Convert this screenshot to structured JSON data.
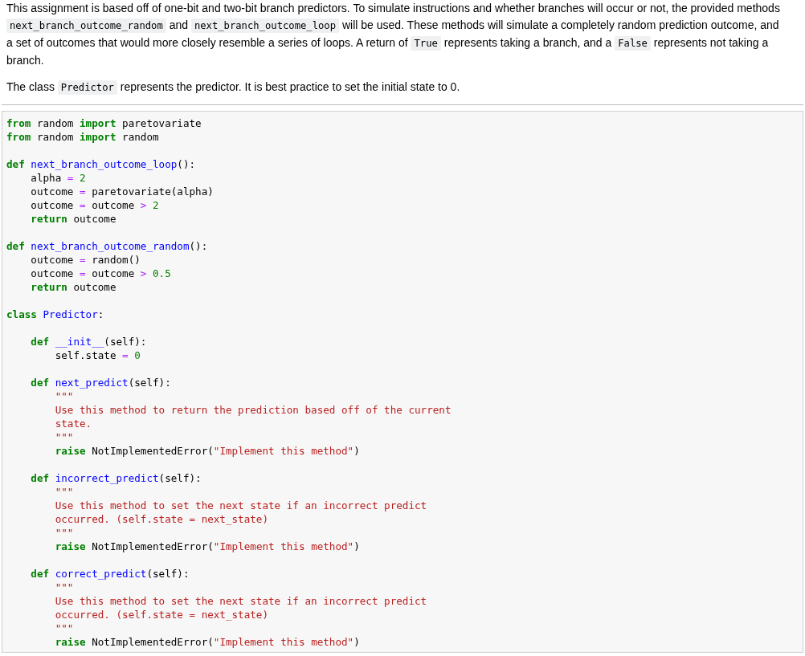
{
  "paragraphs": [
    [
      {
        "kind": "text",
        "text": "This assignment is based off of one-bit and two-bit branch predictors. To simulate instructions and whether branches will occur or not, the provided methods "
      },
      {
        "kind": "code",
        "text": "next_branch_outcome_random"
      },
      {
        "kind": "text",
        "text": " and "
      },
      {
        "kind": "code",
        "text": "next_branch_outcome_loop"
      },
      {
        "kind": "text",
        "text": " will be used. These methods will simulate a completely random prediction outcome, and a set of outcomes that would more closely resemble a series of loops. A return of "
      },
      {
        "kind": "code",
        "text": "True"
      },
      {
        "kind": "text",
        "text": " represents taking a branch, and a "
      },
      {
        "kind": "code",
        "text": "False"
      },
      {
        "kind": "text",
        "text": " represents not taking a branch."
      }
    ],
    [
      {
        "kind": "text",
        "text": "The class "
      },
      {
        "kind": "code",
        "text": "Predictor"
      },
      {
        "kind": "text",
        "text": " represents the predictor. It is best practice to set the initial state to 0."
      }
    ]
  ],
  "code_blocks": [
    [
      [
        {
          "kind": "keyword",
          "text": "from"
        },
        {
          "kind": "plain",
          "text": " random "
        },
        {
          "kind": "keyword",
          "text": "import"
        },
        {
          "kind": "plain",
          "text": " paretovariate"
        }
      ],
      [
        {
          "kind": "keyword",
          "text": "from"
        },
        {
          "kind": "plain",
          "text": " random "
        },
        {
          "kind": "keyword",
          "text": "import"
        },
        {
          "kind": "plain",
          "text": " random"
        }
      ]
    ],
    [
      [
        {
          "kind": "keyword",
          "text": "def "
        },
        {
          "kind": "name",
          "text": "next_branch_outcome_loop"
        },
        {
          "kind": "plain",
          "text": "():"
        }
      ],
      [
        {
          "kind": "plain",
          "text": "    alpha "
        },
        {
          "kind": "operator",
          "text": "="
        },
        {
          "kind": "number",
          "text": " 2"
        }
      ],
      [
        {
          "kind": "plain",
          "text": "    outcome "
        },
        {
          "kind": "operator",
          "text": "="
        },
        {
          "kind": "plain",
          "text": " paretovariate(alpha)"
        }
      ],
      [
        {
          "kind": "plain",
          "text": "    outcome "
        },
        {
          "kind": "operator",
          "text": "="
        },
        {
          "kind": "plain",
          "text": " outcome "
        },
        {
          "kind": "operator",
          "text": ">"
        },
        {
          "kind": "number",
          "text": " 2"
        }
      ],
      [
        {
          "kind": "keyword",
          "text": "    return"
        },
        {
          "kind": "plain",
          "text": " outcome"
        }
      ]
    ],
    [
      [
        {
          "kind": "keyword",
          "text": "def "
        },
        {
          "kind": "name",
          "text": "next_branch_outcome_random"
        },
        {
          "kind": "plain",
          "text": "():"
        }
      ],
      [
        {
          "kind": "plain",
          "text": "    outcome "
        },
        {
          "kind": "operator",
          "text": "="
        },
        {
          "kind": "plain",
          "text": " random()"
        }
      ],
      [
        {
          "kind": "plain",
          "text": "    outcome "
        },
        {
          "kind": "operator",
          "text": "="
        },
        {
          "kind": "plain",
          "text": " outcome "
        },
        {
          "kind": "operator",
          "text": ">"
        },
        {
          "kind": "number",
          "text": " 0.5"
        }
      ],
      [
        {
          "kind": "keyword",
          "text": "    return"
        },
        {
          "kind": "plain",
          "text": " outcome"
        }
      ]
    ],
    [
      [
        {
          "kind": "keyword",
          "text": "class "
        },
        {
          "kind": "name",
          "text": "Predictor"
        },
        {
          "kind": "plain",
          "text": ":"
        }
      ]
    ],
    [
      [
        {
          "kind": "keyword",
          "text": "    def "
        },
        {
          "kind": "name",
          "text": "__init__"
        },
        {
          "kind": "plain",
          "text": "(self):"
        }
      ],
      [
        {
          "kind": "plain",
          "text": "        self.state "
        },
        {
          "kind": "operator",
          "text": "="
        },
        {
          "kind": "number",
          "text": " 0"
        }
      ]
    ],
    [
      [
        {
          "kind": "keyword",
          "text": "    def "
        },
        {
          "kind": "name",
          "text": "next_predict"
        },
        {
          "kind": "plain",
          "text": "(self):"
        }
      ],
      [
        {
          "kind": "string",
          "text": "        \"\"\""
        }
      ],
      [
        {
          "kind": "string",
          "text": "        Use this method to return the prediction based off of the current"
        }
      ],
      [
        {
          "kind": "string",
          "text": "        state."
        }
      ],
      [
        {
          "kind": "string",
          "text": "        \"\"\""
        }
      ],
      [
        {
          "kind": "keyword",
          "text": "        raise"
        },
        {
          "kind": "plain",
          "text": " NotImplementedError("
        },
        {
          "kind": "string",
          "text": "\"Implement this method\""
        },
        {
          "kind": "plain",
          "text": ")"
        }
      ]
    ],
    [
      [
        {
          "kind": "keyword",
          "text": "    def "
        },
        {
          "kind": "name",
          "text": "incorrect_predict"
        },
        {
          "kind": "plain",
          "text": "(self):"
        }
      ],
      [
        {
          "kind": "string",
          "text": "        \"\"\""
        }
      ],
      [
        {
          "kind": "string",
          "text": "        Use this method to set the next state if an incorrect predict"
        }
      ],
      [
        {
          "kind": "string",
          "text": "        occurred. (self.state = next_state)"
        }
      ],
      [
        {
          "kind": "string",
          "text": "        \"\"\""
        }
      ],
      [
        {
          "kind": "keyword",
          "text": "        raise"
        },
        {
          "kind": "plain",
          "text": " NotImplementedError("
        },
        {
          "kind": "string",
          "text": "\"Implement this method\""
        },
        {
          "kind": "plain",
          "text": ")"
        }
      ]
    ],
    [
      [
        {
          "kind": "keyword",
          "text": "    def "
        },
        {
          "kind": "name",
          "text": "correct_predict"
        },
        {
          "kind": "plain",
          "text": "(self):"
        }
      ],
      [
        {
          "kind": "string",
          "text": "        \"\"\""
        }
      ],
      [
        {
          "kind": "string",
          "text": "        Use this method to set the next state if an incorrect predict"
        }
      ],
      [
        {
          "kind": "string",
          "text": "        occurred. (self.state = next_state)"
        }
      ],
      [
        {
          "kind": "string",
          "text": "        \"\"\""
        }
      ],
      [
        {
          "kind": "keyword",
          "text": "        raise"
        },
        {
          "kind": "plain",
          "text": " NotImplementedError("
        },
        {
          "kind": "string",
          "text": "\"Implement this method\""
        },
        {
          "kind": "plain",
          "text": ")"
        }
      ]
    ]
  ]
}
